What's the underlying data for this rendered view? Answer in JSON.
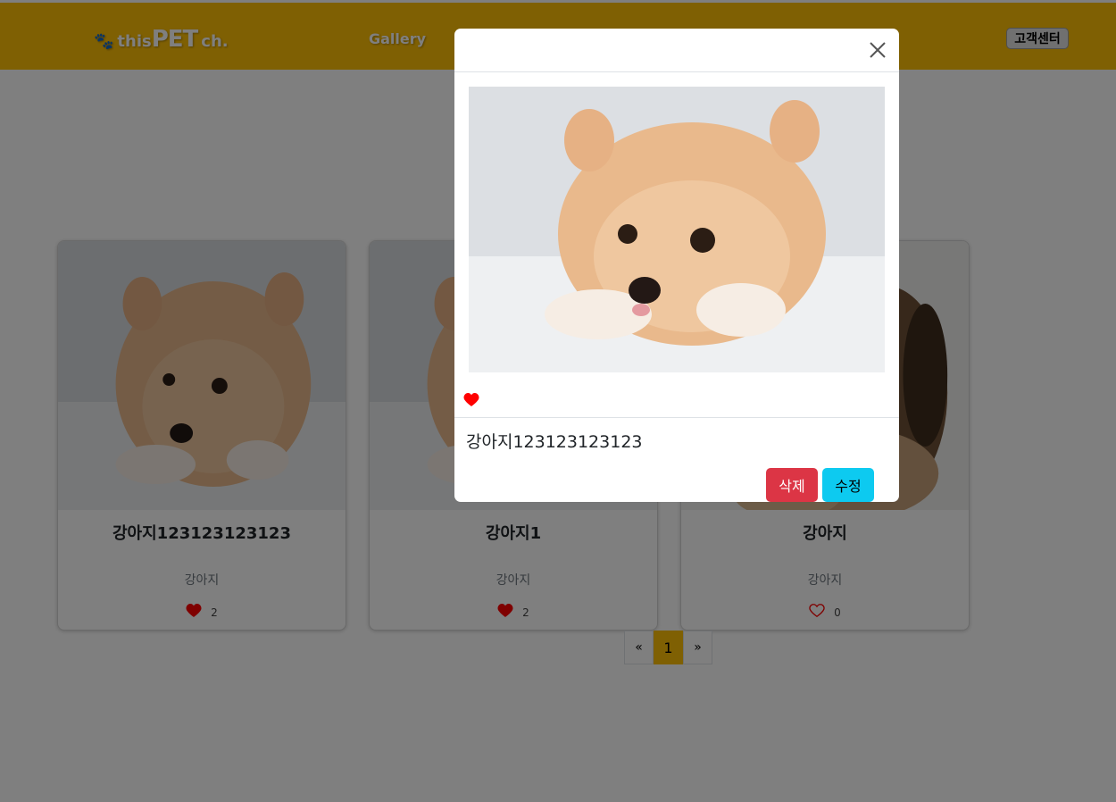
{
  "navbar": {
    "logo_this": "this",
    "logo_pet": "PET",
    "logo_ch": "ch.",
    "gallery_label": "Gallery",
    "support_label": "고객센터",
    "color": "#ffc107"
  },
  "cards": [
    {
      "title": "강아지123123123123",
      "category": "강아지",
      "likes": "2",
      "liked": true,
      "image": "pomeranian"
    },
    {
      "title": "강아지1",
      "category": "강아지",
      "likes": "2",
      "liked": true,
      "image": "pomeranian"
    },
    {
      "title": "강아지",
      "category": "강아지",
      "likes": "0",
      "liked": false,
      "image": "brown-dog"
    }
  ],
  "pagination": {
    "prev": "«",
    "current": "1",
    "next": "»"
  },
  "modal": {
    "title": "강아지123123123123",
    "liked": true,
    "delete_label": "삭제",
    "edit_label": "수정"
  }
}
